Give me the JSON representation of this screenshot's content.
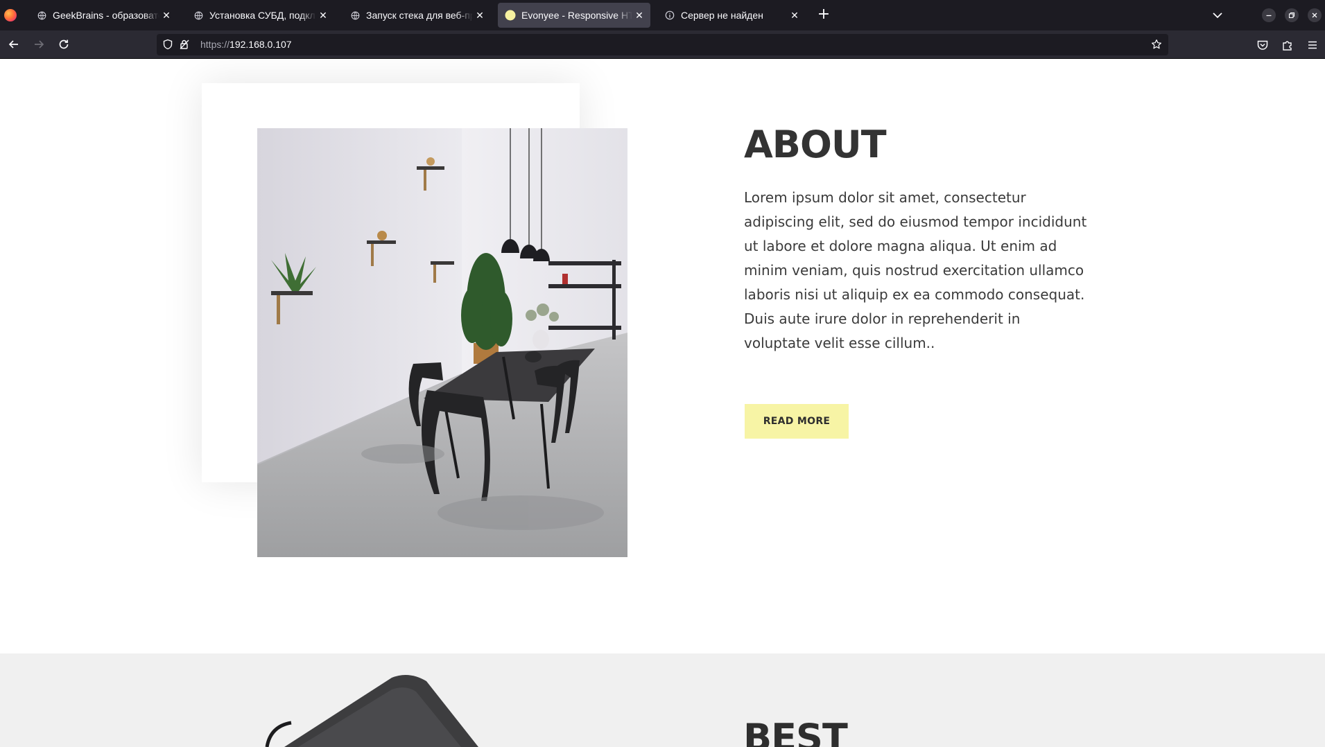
{
  "browser": {
    "tabs": [
      {
        "title": "GeekBrains - образовательный портал",
        "icon": "globe-icon",
        "active": false
      },
      {
        "title": "Установка СУБД, подключение",
        "icon": "globe-icon",
        "active": false
      },
      {
        "title": "Запуск стека для веб-приложения",
        "icon": "globe-icon",
        "active": false
      },
      {
        "title": "Evonyee - Responsive HTML",
        "icon": "site-favicon",
        "active": true
      },
      {
        "title": "Сервер не найден",
        "icon": "info-icon",
        "active": false
      }
    ],
    "close_glyph": "✕",
    "new_tab_glyph": "+",
    "url": {
      "scheme": "https://",
      "host": "192.168.0.107"
    }
  },
  "about": {
    "title": "ABOUT",
    "body": "Lorem ipsum dolor sit amet, consectetur adipiscing elit, sed do eiusmod tempor incididunt ut labore et dolore magna aliqua. Ut enim ad minim veniam, quis nostrud exercitation ullamco laboris nisi ut aliquip ex ea commodo consequat. Duis aute irure dolor in reprehenderit in voluptate velit esse cillum..",
    "button_label": "READ MORE",
    "button_color": "#f7f4a5"
  },
  "best": {
    "title": "BEST"
  }
}
